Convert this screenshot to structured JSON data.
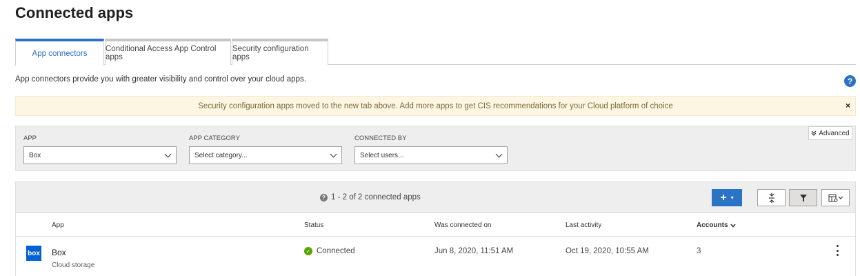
{
  "page": {
    "title": "Connected apps"
  },
  "tabs": [
    {
      "label": "App connectors",
      "active": true
    },
    {
      "label": "Conditional Access App Control apps",
      "active": false
    },
    {
      "label": "Security configuration apps",
      "active": false
    }
  ],
  "description": "App connectors provide you with greater visibility and control over your cloud apps.",
  "help": {
    "glyph": "?"
  },
  "banner": {
    "text": "Security configuration apps moved to the new tab above. Add more apps to get CIS recommendations for your Cloud platform of choice",
    "close_glyph": "×"
  },
  "filters": {
    "app": {
      "label": "APP",
      "value": "Box"
    },
    "category": {
      "label": "APP CATEGORY",
      "value": "Select category..."
    },
    "connected_by": {
      "label": "CONNECTED BY",
      "value": "Select users..."
    },
    "advanced_label": "Advanced"
  },
  "toolbar": {
    "count_text": "1 - 2 of 2 connected apps",
    "count_icon_glyph": "?"
  },
  "table": {
    "columns": {
      "app": "App",
      "status": "Status",
      "connected_on": "Was connected on",
      "last_activity": "Last activity",
      "accounts": "Accounts"
    },
    "rows": [
      {
        "logo_text": "box",
        "name": "Box",
        "category": "Cloud storage",
        "status": "Connected",
        "connected_on": "Jun 8, 2020, 11:51 AM",
        "last_activity": "Oct 19, 2020, 10:55 AM",
        "accounts": "3"
      }
    ]
  },
  "colors": {
    "accent": "#2b73c5",
    "box_brand": "#0061d5",
    "connected": "#57a300",
    "banner_bg": "#fdf6e3"
  },
  "icons": {
    "help": "question-circle-icon",
    "close": "close-icon",
    "add": "plus-icon",
    "collapse": "collapse-rows-icon",
    "filter": "filter-icon",
    "columns": "column-settings-icon",
    "status_ok": "check-circle-icon",
    "more": "more-vertical-icon"
  }
}
